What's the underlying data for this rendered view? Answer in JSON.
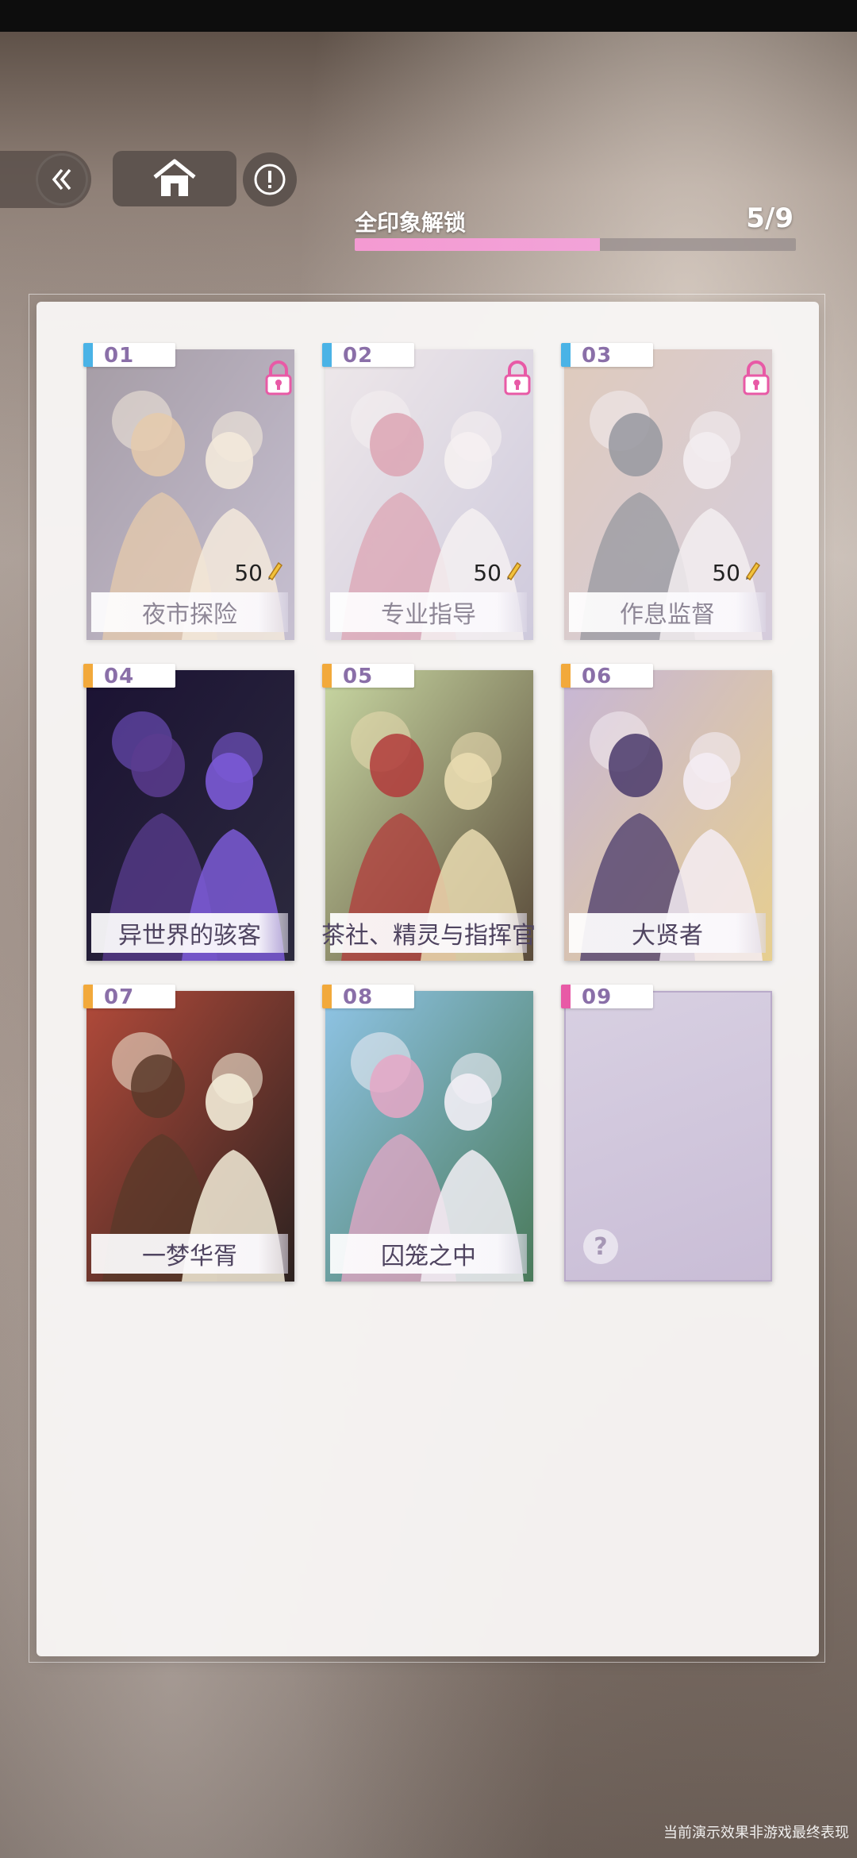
{
  "progress": {
    "label": "全印象解锁",
    "count": "5/9",
    "fraction": 0.556
  },
  "cards": [
    {
      "num": "01",
      "title": "夜市探险",
      "locked": true,
      "cost": "50",
      "stripe": "#4ab3e6"
    },
    {
      "num": "02",
      "title": "专业指导",
      "locked": true,
      "cost": "50",
      "stripe": "#4ab3e6"
    },
    {
      "num": "03",
      "title": "作息监督",
      "locked": true,
      "cost": "50",
      "stripe": "#4ab3e6"
    },
    {
      "num": "04",
      "title": "异世界的骇客",
      "locked": false,
      "stripe": "#f2a93b"
    },
    {
      "num": "05",
      "title": "茶社、精灵与指挥官",
      "locked": false,
      "stripe": "#f2a93b"
    },
    {
      "num": "06",
      "title": "大贤者",
      "locked": false,
      "stripe": "#f2a93b"
    },
    {
      "num": "07",
      "title": "一梦华胥",
      "locked": false,
      "stripe": "#f2a93b"
    },
    {
      "num": "08",
      "title": "囚笼之中",
      "locked": false,
      "stripe": "#f2a93b"
    },
    {
      "num": "09",
      "title": "",
      "locked": false,
      "empty": true,
      "stripe": "#e85aa6",
      "placeholder": "?"
    }
  ],
  "disclaimer": "当前演示效果非游戏最终表现",
  "icons": {
    "back": "double-chevron-left-icon",
    "home": "home-icon",
    "info": "exclamation-circle-icon",
    "lock": "padlock-icon",
    "cost": "pencil-icon"
  }
}
